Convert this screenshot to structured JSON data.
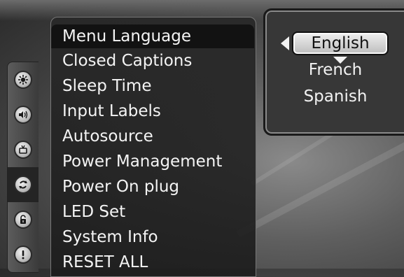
{
  "menu": {
    "items": [
      {
        "label": "Menu Language"
      },
      {
        "label": "Closed Captions"
      },
      {
        "label": "Sleep Time"
      },
      {
        "label": "Input Labels"
      },
      {
        "label": "Autosource"
      },
      {
        "label": "Power Management"
      },
      {
        "label": "Power On plug"
      },
      {
        "label": "LED Set"
      },
      {
        "label": "System Info"
      },
      {
        "label": "RESET ALL"
      }
    ],
    "selected_index": 0
  },
  "language_panel": {
    "selected": "English",
    "options": [
      "French",
      "Spanish"
    ]
  },
  "side_rail": {
    "icons": [
      "picture-settings-icon",
      "audio-icon",
      "tv-channel-icon",
      "setup-icon",
      "lock-icon",
      "help-icon"
    ],
    "active_index": 3
  },
  "colors": {
    "menu_bg": "#1e1e1e",
    "selected_bg": "#121212",
    "text": "#f4f4f4",
    "panel_bg": "#373737"
  }
}
